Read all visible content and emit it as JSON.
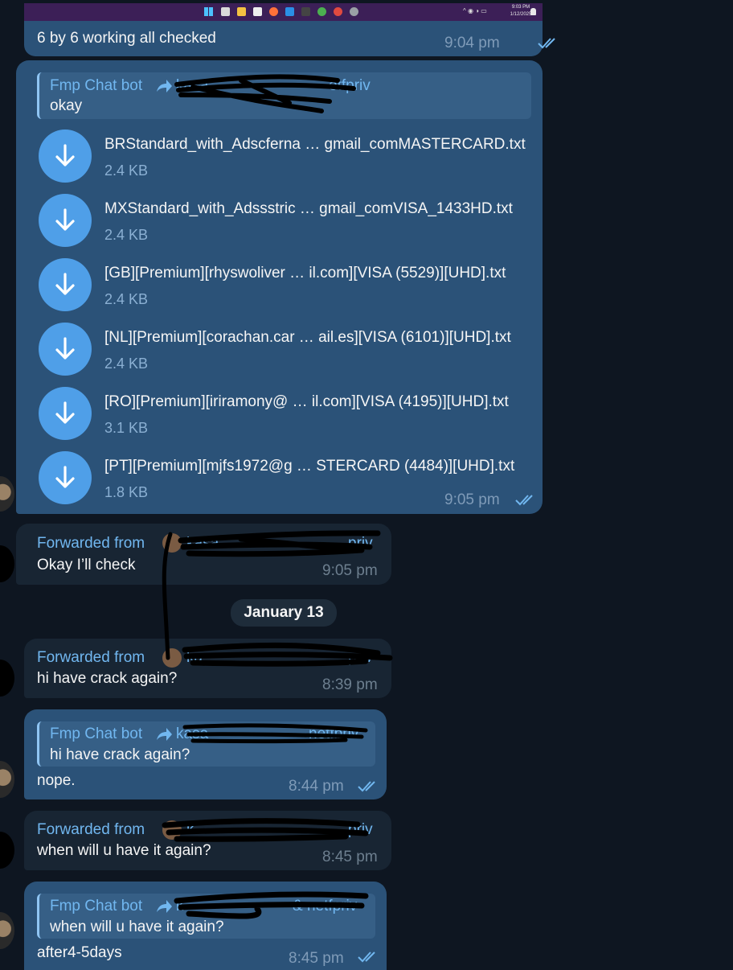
{
  "taskbar": {
    "time": "9:03 PM",
    "date": "1/12/2025"
  },
  "messages": {
    "m1": {
      "text": "6 by 6 working all checked",
      "time": "9:04 pm"
    },
    "m2": {
      "reply_sender": "Fmp Chat bot",
      "reply_forward_name": "kasa",
      "reply_forward_tail": "etfpriv",
      "reply_text": "okay",
      "files": [
        {
          "name": "BRStandard_with_Adscferna … gmail_comMASTERCARD.txt",
          "size": "2.4 KB"
        },
        {
          "name": "MXStandard_with_Adssstric  …  gmail_comVISA_1433HD.txt",
          "size": "2.4 KB"
        },
        {
          "name": "[GB][Premium][rhyswoliver … il.com][VISA (5529)][UHD].txt",
          "size": "2.4 KB"
        },
        {
          "name": "[NL][Premium][corachan.car … ail.es][VISA (6101)][UHD].txt",
          "size": "2.4 KB"
        },
        {
          "name": "[RO][Premium][iriramony@ … il.com][VISA (4195)][UHD].txt",
          "size": "3.1 KB"
        },
        {
          "name": "[PT][Premium][mjfs1972@g  …  STERCARD (4484)][UHD].txt",
          "size": "1.8 KB"
        }
      ],
      "time": "9:05 pm"
    },
    "m3": {
      "forwarded_label": "Forwarded from",
      "forward_name": "kasa",
      "forward_tail": "priv",
      "text": "Okay I’ll check",
      "time": "9:05 pm"
    },
    "date_separator": "January 13",
    "m4": {
      "forwarded_label": "Forwarded from",
      "forward_name": "ka",
      "forward_tail": "priv",
      "text": "hi have crack again?",
      "time": "8:39 pm"
    },
    "m5": {
      "reply_sender": "Fmp Chat bot",
      "reply_forward_name": "kasa",
      "reply_forward_tail": "netfpriv",
      "reply_text": "hi have crack again?",
      "text": "nope.",
      "time": "8:44 pm"
    },
    "m6": {
      "forwarded_label": "Forwarded from",
      "forward_name": "k",
      "forward_tail": "priv",
      "text": "when will u have it again?",
      "time": "8:45 pm"
    },
    "m7": {
      "reply_sender": "Fmp Chat bot",
      "reply_forward_name": "k",
      "reply_forward_tail": "& netfpriv",
      "reply_text": "when will u have it again?",
      "text": "after4-5days",
      "time": "8:45 pm"
    }
  },
  "colors": {
    "background": "#0e1621",
    "bubble_outgoing": "#2b5278",
    "bubble_incoming": "#182533",
    "accent": "#71b7f0",
    "download_button": "#4f9fe8",
    "taskbar": "#3c1f57"
  }
}
